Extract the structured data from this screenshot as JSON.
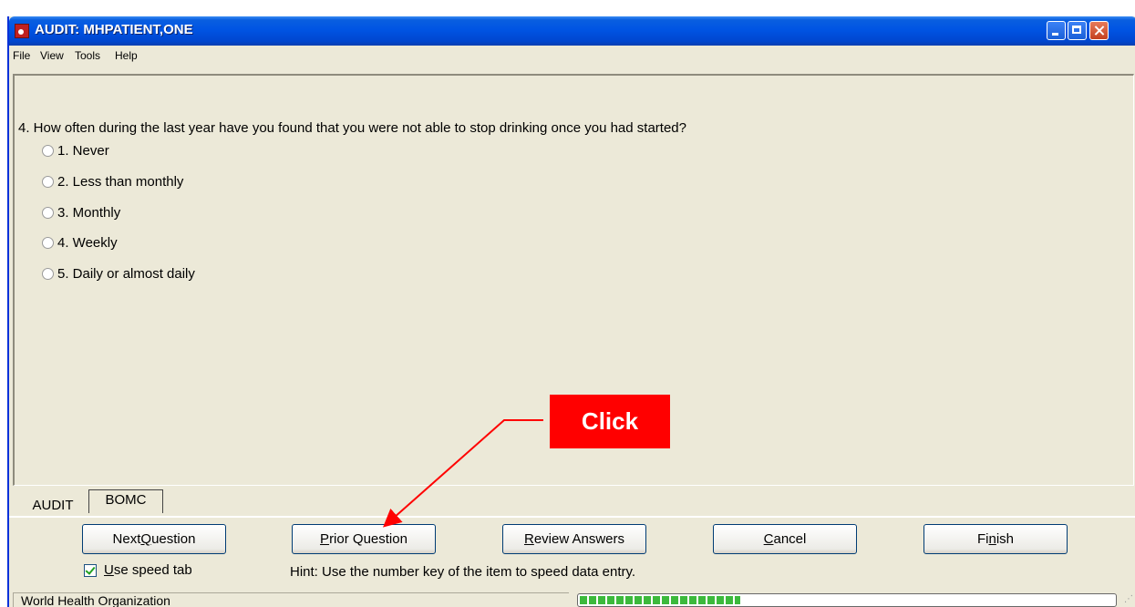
{
  "window": {
    "title": "AUDIT: MHPATIENT,ONE"
  },
  "menu": [
    "File",
    "View",
    "Tools",
    "Help"
  ],
  "question": {
    "text": "4. How often during the last year have you found that you were not able to stop drinking once you had started?",
    "options": [
      "1. Never",
      "2. Less than monthly",
      "3. Monthly",
      "4. Weekly",
      "5. Daily or almost daily"
    ]
  },
  "tabs": {
    "active": "AUDIT",
    "inactive": "BOMC"
  },
  "buttons": {
    "next": {
      "pre": "Next ",
      "key": "Q",
      "post": "uestion"
    },
    "prior": {
      "pre": "",
      "key": "P",
      "post": "rior Question"
    },
    "review": {
      "pre": "",
      "key": "R",
      "post": "eview Answers"
    },
    "cancel": {
      "pre": "",
      "key": "C",
      "post": "ancel"
    },
    "finish": {
      "pre": "Fi",
      "key": "n",
      "post": "ish"
    }
  },
  "speed_tab": {
    "checked": true,
    "key": "U",
    "post": "se speed tab"
  },
  "hint": "Hint: Use the number key of the item to speed data entry.",
  "status": {
    "left": "World Health Organization"
  },
  "progress": {
    "fraction": 0.3
  },
  "annotation": {
    "label": "Click",
    "color": "#ff0000"
  },
  "colors": {
    "window_bg": "#ece9d8",
    "titlebar": "#0054e3",
    "progress": "#3cb93c"
  }
}
